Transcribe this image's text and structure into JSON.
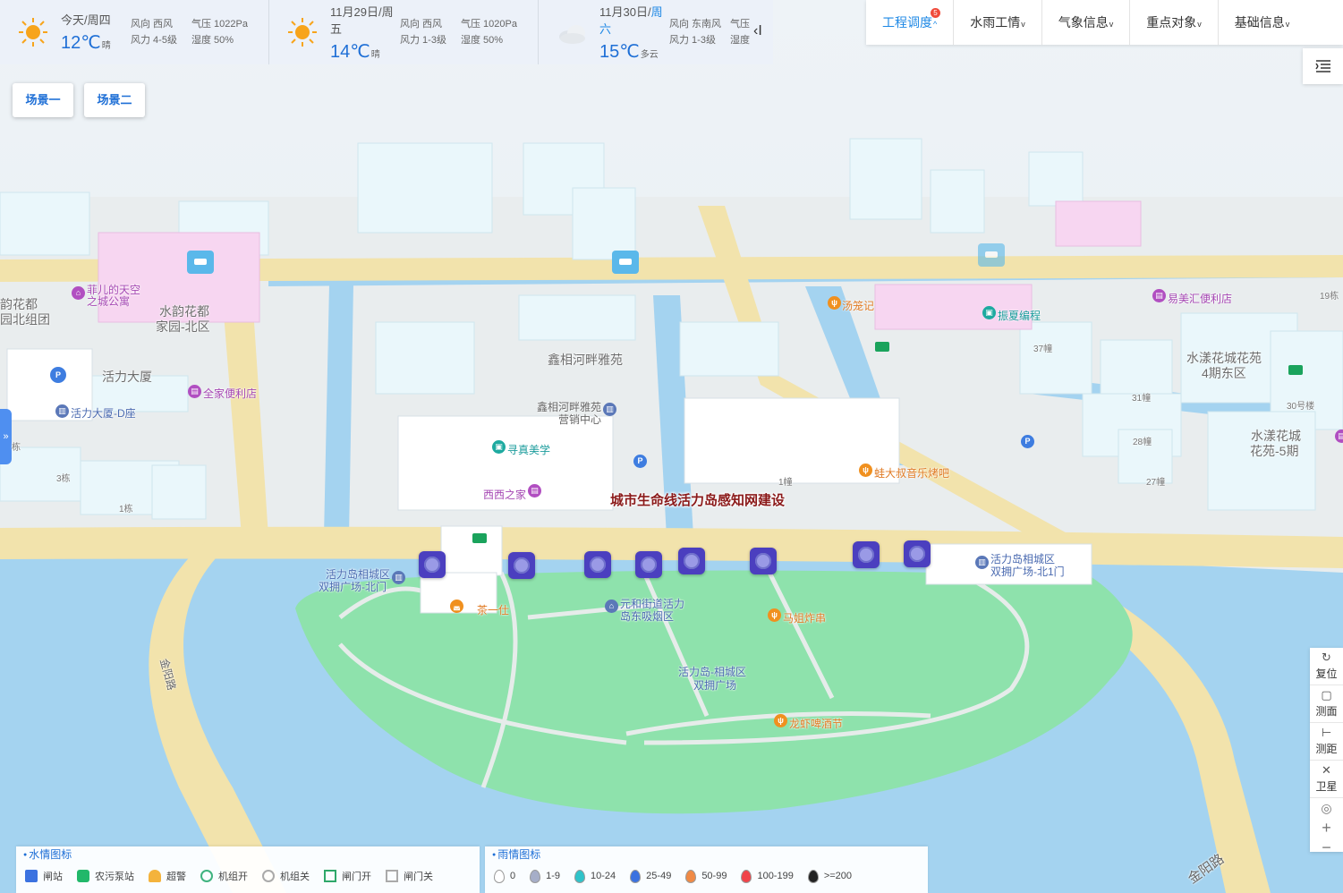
{
  "weather": [
    {
      "date": "今天/周四",
      "weekday_highlight": "",
      "temp": "12℃",
      "cond": "晴",
      "wind_dir": "风向 西风",
      "wind_force": "风力 4-5级",
      "pressure": "气压 1022Pa",
      "humidity": "湿度 50%",
      "icon": "sun-icon"
    },
    {
      "date": "11月29日/周五",
      "weekday_highlight": "",
      "temp": "14℃",
      "cond": "晴",
      "wind_dir": "风向 西风",
      "wind_force": "风力 1-3级",
      "pressure": "气压 1020Pa",
      "humidity": "湿度 50%",
      "icon": "sun-icon"
    },
    {
      "date": "11月30日/",
      "weekday_highlight": "周六",
      "temp": "15℃",
      "cond": "多云",
      "wind_dir": "风向 东南风",
      "wind_force": "风力 1-3级",
      "pressure": "气压",
      "humidity": "湿度",
      "icon": "cloud-icon"
    }
  ],
  "top_menu": {
    "items": [
      "工程调度",
      "水雨工情",
      "气象信息",
      "重点对象",
      "基础信息"
    ],
    "badge": "5"
  },
  "scenes": [
    "场景一",
    "场景二"
  ],
  "left_tab_glyph": "»",
  "project_title": "城市生命线活力岛感知网建设",
  "map_labels": {
    "fuhuadu": "韵花都",
    "fuhuadu2": "园北组团",
    "feier": "菲儿的天空",
    "feier2": "之城公寓",
    "shuiyun": "水韵花都",
    "shuiyun2": "家园-北区",
    "huoli": "活力大厦",
    "quanjia": "全家便利店",
    "huolid": "活力大厦-D座",
    "xinxiang": "鑫相河畔雅苑",
    "yingxiao": "鑫相河畔雅苑",
    "yingxiao2": "营销中心",
    "xunzhen": "寻真美学",
    "xixi": "西西之家",
    "tanglong": "汤笼记",
    "zhenxia": "振夏编程",
    "yimei": "易美汇便利店",
    "shuiyang4": "水漾花城花苑",
    "shuiyang4b": "4期东区",
    "shuiyang5": "水漾花城",
    "shuiyang5b": "花苑-5期",
    "wadashu": "蛙大叔音乐烤吧",
    "xiangcheng_r": "活力岛相城区",
    "xiangcheng_r2": "双拥广场-北1门",
    "xiangcheng_l": "活力岛相城区",
    "xiangcheng_l2": "双拥广场-北门",
    "chayi": "茶一仕",
    "yuanhe": "元和街道活力",
    "yuanhe2": "岛东吸烟区",
    "majie": "马姐炸串",
    "square": "活力岛-相城区",
    "square2": "双拥广场",
    "longxia": "龙虾啤酒节",
    "road_left": "金阳路",
    "road_right": "金阳路",
    "n37": "37幢",
    "n31": "31幢",
    "n28": "28幢",
    "n27": "27幢",
    "n30": "30号楼",
    "n19": "19栋",
    "n1": "1幢",
    "n3": "3栋",
    "n1b": "1栋",
    "n_left": "栋"
  },
  "tools": [
    {
      "label": "复位",
      "icon": "reset-icon",
      "glyph": "↻"
    },
    {
      "label": "测面",
      "icon": "measure-area-icon",
      "glyph": "▢"
    },
    {
      "label": "测距",
      "icon": "measure-distance-icon",
      "glyph": "⊢"
    },
    {
      "label": "卫星",
      "icon": "satellite-icon",
      "glyph": "✕"
    }
  ],
  "zoom": {
    "locate": "◎",
    "in": "+",
    "out": "−"
  },
  "water_legend": {
    "title": "水情图标",
    "items": [
      "闸站",
      "农污泵站",
      "超警",
      "机组开",
      "机组关",
      "闸门开",
      "闸门关"
    ]
  },
  "rain_legend": {
    "title": "雨情图标",
    "items": [
      {
        "label": "0",
        "color": "#ffffff"
      },
      {
        "label": "1-9",
        "color": "#a6aec8"
      },
      {
        "label": "10-24",
        "color": "#2fc3c9"
      },
      {
        "label": "25-49",
        "color": "#3b72e0"
      },
      {
        "label": "50-99",
        "color": "#f08a45"
      },
      {
        "label": "100-199",
        "color": "#f0444a"
      },
      {
        "label": ">=200",
        "color": "#222222"
      }
    ]
  }
}
